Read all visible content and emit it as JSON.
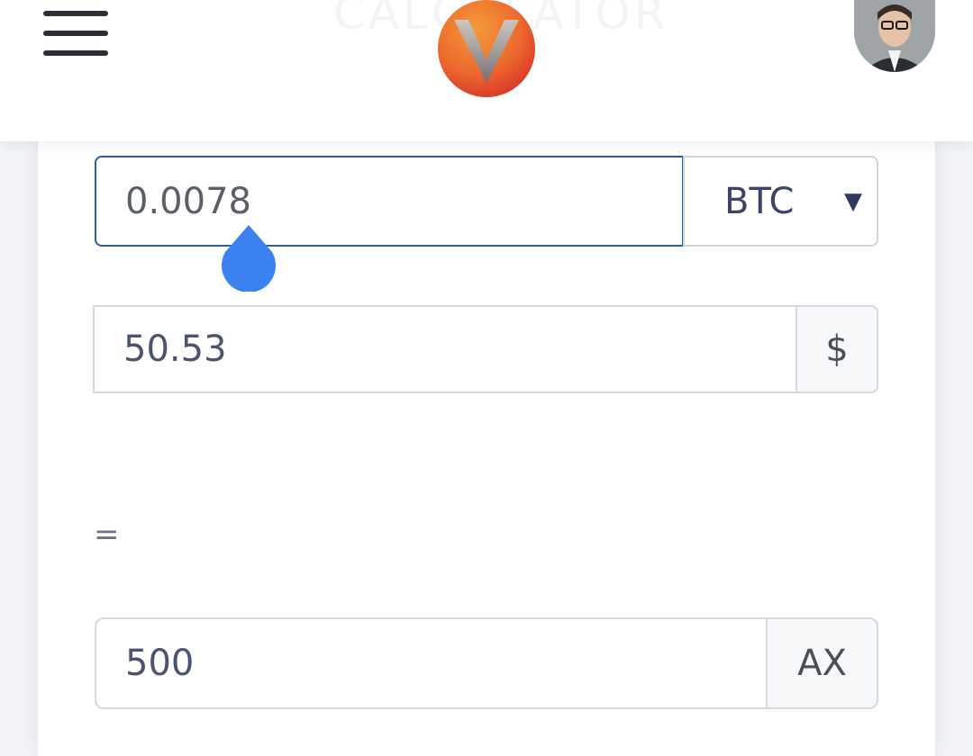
{
  "header": {
    "ghost_title": "CALCULATOR",
    "menu_icon": "hamburger-menu-icon",
    "logo_icon": "v-logo-icon",
    "avatar_icon": "user-avatar"
  },
  "converter": {
    "crypto_amount": "0.0078",
    "crypto_currency": "BTC",
    "fiat_amount": "50.53",
    "fiat_symbol": "$",
    "equals": "=",
    "result_amount": "500",
    "result_unit": "AX"
  },
  "colors": {
    "focus_border": "#2b5fa3",
    "selection_handle": "#3b82f0",
    "logo_orange": "#f07a2a",
    "logo_red": "#e0402e"
  }
}
